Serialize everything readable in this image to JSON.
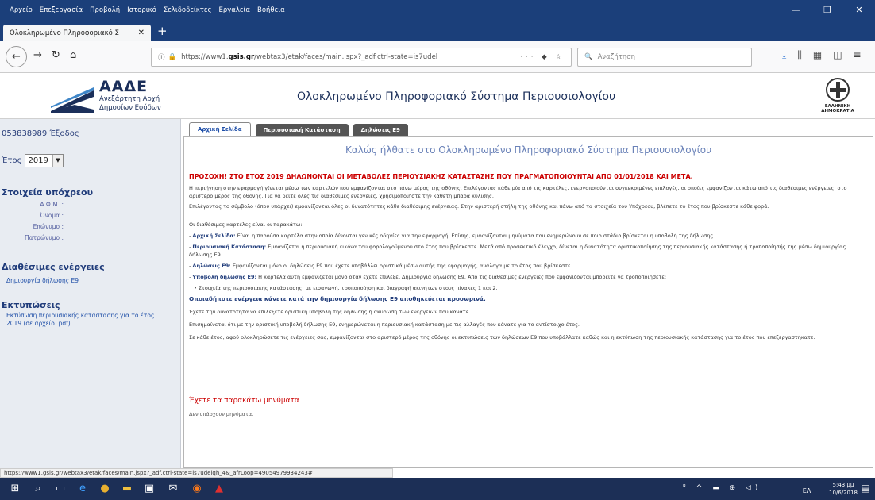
{
  "browser": {
    "menu": [
      "Αρχείο",
      "Επεξεργασία",
      "Προβολή",
      "Ιστορικό",
      "Σελιδοδείκτες",
      "Εργαλεία",
      "Βοήθεια"
    ],
    "tab_title": "Ολοκληρωμένο Πληροφοριακό Σ",
    "url_prefix": "https://www1.",
    "url_domain": "gsis.gr",
    "url_rest": "/webtax3/etak/faces/main.jspx?_adf.ctrl-state=is7udel",
    "search_placeholder": "Αναζήτηση",
    "status_url": "https://www1.gsis.gr/webtax3/etak/faces/main.jspx?_adf.ctrl-state=is7udelqh_4&_afrLoop=49054979934243#"
  },
  "site": {
    "brand_name": "ΑΑΔΕ",
    "brand_sub1": "Ανεξάρτητη Αρχή",
    "brand_sub2": "Δημοσίων Εσόδων",
    "title": "Ολοκληρωμένο Πληροφοριακό Σύστημα Περιουσιολογίου",
    "emblem_text": "ΕΛΛΗΝΙΚΗ ΔΗΜΟΚΡΑΤΙΑ"
  },
  "sidebar": {
    "user": "053838989",
    "logout": "Έξοδος",
    "year_label": "Έτος",
    "year_value": "2019",
    "subject_heading": "Στοιχεία υπόχρεου",
    "fields": [
      "Α.Φ.Μ.",
      "Όνομα",
      "Επώνυμο",
      "Πατρώνυμο"
    ],
    "actions_heading": "Διαθέσιμες ενέργειες",
    "action_link": "Δημιουργία δήλωσης Ε9",
    "prints_heading": "Εκτυπώσεις",
    "print_link": "Εκτύπωση περιουσιακής κατάστασης για το έτος 2019 (σε αρχείο .pdf)"
  },
  "tabs": [
    "Αρχική Σελίδα",
    "Περιουσιακή Κατάσταση",
    "Δηλώσεις Ε9"
  ],
  "content": {
    "welcome": "Καλώς ήλθατε στο Ολοκληρωμένο Πληροφοριακό Σύστημα Περιουσιολογίου",
    "warning": "ΠΡΟΣΟΧΗ! ΣΤΟ ΕΤΟΣ 2019 ΔΗΛΩΝΟΝΤΑΙ ΟΙ ΜΕΤΑΒΟΛΕΣ ΠΕΡΙΟΥΣΙΑΚΗΣ ΚΑΤΑΣΤΑΣΗΣ ΠΟΥ ΠΡΑΓΜΑΤΟΠΟΙΟΥΝΤΑΙ ΑΠΟ 01/01/2018 ΚΑΙ ΜΕΤΑ.",
    "p1": "Η περιήγηση στην εφαρμογή γίνεται μέσω των καρτελών που εμφανίζονται στο πάνω μέρος της οθόνης. Επιλέγοντας κάθε μία από τις καρτέλες, ενεργοποιούνται συγκεκριμένες επιλογές, οι οποίες εμφανίζονται κάτω από τις διαθέσιμες ενέργειες, στο αριστερό μέρος της οθόνης. Για να δείτε όλες τις διαθέσιμες ενέργειες, χρησιμοποιήστε την κάθετη μπάρα κύλισης.",
    "p2": "Επιλέγοντας το σύμβολο (όπου υπάρχει) εμφανίζονται όλες οι δυνατότητες κάθε διαθέσιμης ενέργειας. Στην αριστερή στήλη της οθόνης και πάνω από τα στοιχεία του Υπόχρεου, βλέπετε το έτος που βρίσκεστε κάθε φορά.",
    "p3": "Οι διαθέσιμες καρτέλες είναι οι παρακάτω:",
    "i1_t": "Αρχική Σελίδα:",
    "i1": "Είναι η παρούσα καρτέλα στην οποία δίνονται γενικές οδηγίες για την εφαρμογή. Επίσης, εμφανίζονται μηνύματα που ενημερώνουν σε ποιο στάδιο βρίσκεται η υποβολή της δήλωσης.",
    "i2_t": "Περιουσιακή Κατάσταση:",
    "i2": "Εμφανίζεται η περιουσιακή εικόνα του φορολογούμενου στο έτος που βρίσκεστε. Μετά από προσεκτικό έλεγχο, δίνεται η δυνατότητα οριστικοποίησης της περιουσιακής κατάστασης ή τροποποίησής της μέσω δημιουργίας δήλωσης Ε9.",
    "i3_t": "Δηλώσεις Ε9:",
    "i3": "Εμφανίζονται μόνο οι δηλώσεις Ε9 που έχετε υποβάλλει οριστικά μέσω αυτής της εφαρμογής, ανάλογα με το έτος που βρίσκεστε.",
    "i4_t": "Υποβολή δήλωσης Ε9:",
    "i4": "Η καρτέλα αυτή εμφανίζεται μόνο όταν έχετε επιλέξει Δημιουργία δήλωσης Ε9. Από τις διαθέσιμες ενέργειες που εμφανίζονται μπορείτε να τροποποιήσετε:",
    "bullet": "Στοιχεία της περιουσιακής κατάστασης, με εισαγωγή, τροποποίηση και διαγραφή ακινήτων στους πίνακες 1 και 2.",
    "underline": "Οποιαδήποτε ενέργεια κάνετε κατά την δημιουργία δήλωσης Ε9 αποθηκεύεται προσωρινά.",
    "p4": "Έχετε την δυνατότητα να επιλέξετε οριστική υποβολή της δήλωσης ή ακύρωση των ενεργειών που κάνατε.",
    "p5": "Επισημαίνεται ότι με την οριστική υποβολή δήλωσης Ε9, ενημερώνεται η περιουσιακή κατάσταση με τις αλλαγές που κάνατε για το αντίστοιχο έτος.",
    "p6": "Σε κάθε έτος, αφού ολοκληρώσετε τις ενέργειες σας, εμφανίζονται στο αριστερό μέρος της οθόνης οι εκτυπώσεις των δηλώσεων Ε9 που υποβάλλατε καθώς και η εκτύπωση της περιουσιακής κατάστασης για το έτος που επεξεργαστήκατε.",
    "msg_heading": "Έχετε τα παρακάτω μηνύματα",
    "msg_text": "Δεν υπάρχουν μηνύματα."
  },
  "taskbar": {
    "lang": "ΕΛ",
    "time": "5:43 μμ",
    "date": "10/6/2018"
  }
}
